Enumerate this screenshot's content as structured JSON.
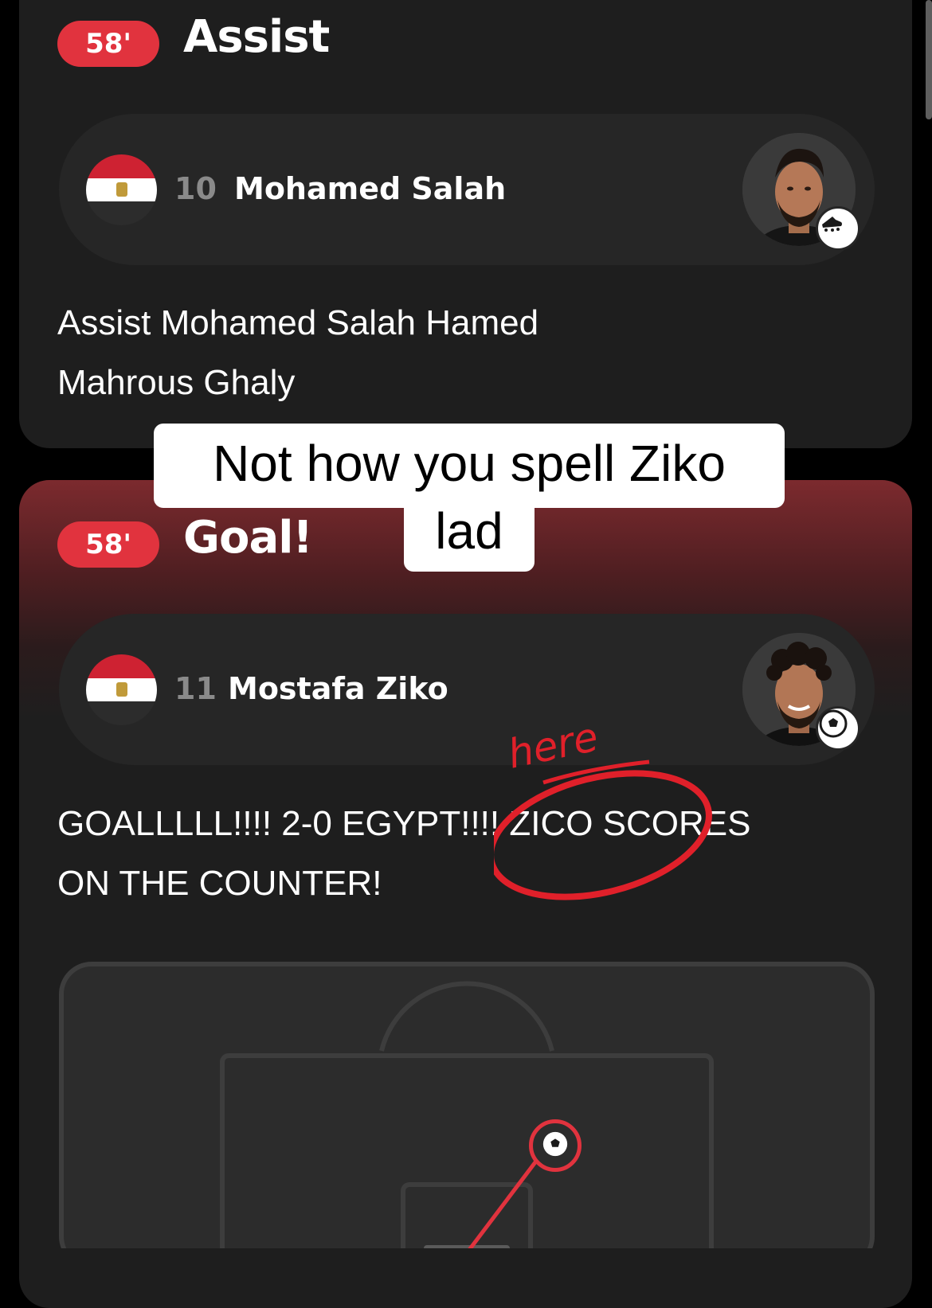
{
  "assist_event": {
    "minute": "58'",
    "title": "Assist",
    "player": {
      "number": "10",
      "name": "Mohamed Salah",
      "flag": "Egypt",
      "event_icon": "boot-icon"
    },
    "description_line1": "Assist Mohamed Salah Hamed",
    "description_line2": "Mahrous Ghaly"
  },
  "goal_event": {
    "minute": "58'",
    "title": "Goal!",
    "player": {
      "number": "11",
      "name": "Mostafa Ziko",
      "flag": "Egypt",
      "event_icon": "football-icon"
    },
    "description_line1": "GOALLLLL!!!! 2-0 EGYPT!!!! ZICO SCORES",
    "description_line2": "ON THE COUNTER!",
    "shot_marker_icon": "football-icon"
  },
  "overlay": {
    "caption_line1": "Not how you spell Ziko",
    "caption_line2": "lad",
    "handwritten_note": "here"
  },
  "colors": {
    "accent_red": "#e1333e",
    "card_bg": "#1e1e1e",
    "pill_bg": "#262626",
    "annotation_red": "#e0202a"
  }
}
